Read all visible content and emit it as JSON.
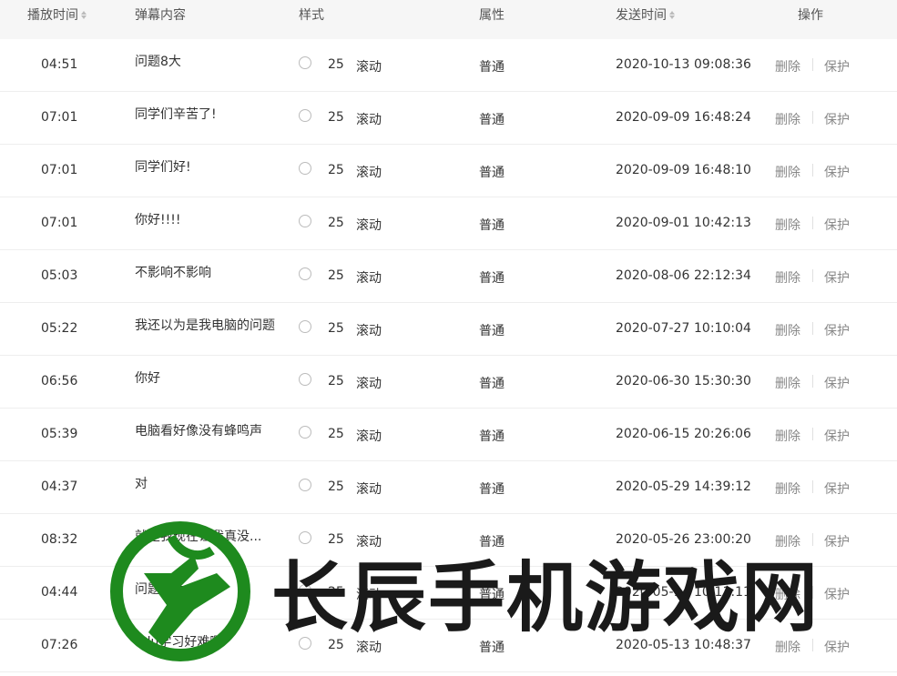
{
  "header": {
    "play_time": "播放时间",
    "content": "弹幕内容",
    "style": "样式",
    "attribute": "属性",
    "send_time": "发送时间",
    "action": "操作"
  },
  "rows": [
    {
      "time": "04:51",
      "text": "问题8大",
      "size": "25",
      "mode": "滚动",
      "attr": "普通",
      "date": "2020-10-13",
      "clock": "09:08:36",
      "del": "删除",
      "protect": "保护"
    },
    {
      "time": "07:01",
      "text": "同学们辛苦了!",
      "size": "25",
      "mode": "滚动",
      "attr": "普通",
      "date": "2020-09-09",
      "clock": "16:48:24",
      "del": "删除",
      "protect": "保护"
    },
    {
      "time": "07:01",
      "text": "同学们好!",
      "size": "25",
      "mode": "滚动",
      "attr": "普通",
      "date": "2020-09-09",
      "clock": "16:48:10",
      "del": "删除",
      "protect": "保护"
    },
    {
      "time": "07:01",
      "text": "你好!!!!",
      "size": "25",
      "mode": "滚动",
      "attr": "普通",
      "date": "2020-09-01",
      "clock": "10:42:13",
      "del": "删除",
      "protect": "保护"
    },
    {
      "time": "05:03",
      "text": "不影响不影响",
      "size": "25",
      "mode": "滚动",
      "attr": "普通",
      "date": "2020-08-06",
      "clock": "22:12:34",
      "del": "删除",
      "protect": "保护"
    },
    {
      "time": "05:22",
      "text": "我还以为是我电脑的问题",
      "size": "25",
      "mode": "滚动",
      "attr": "普通",
      "date": "2020-07-27",
      "clock": "10:10:04",
      "del": "删除",
      "protect": "保护"
    },
    {
      "time": "06:56",
      "text": "你好",
      "size": "25",
      "mode": "滚动",
      "attr": "普通",
      "date": "2020-06-30",
      "clock": "15:30:30",
      "del": "删除",
      "protect": "保护"
    },
    {
      "time": "05:39",
      "text": "电脑看好像没有蜂鸣声",
      "size": "25",
      "mode": "滚动",
      "attr": "普通",
      "date": "2020-06-15",
      "clock": "20:26:06",
      "del": "删除",
      "protect": "保护"
    },
    {
      "time": "04:37",
      "text": "对",
      "size": "25",
      "mode": "滚动",
      "attr": "普通",
      "date": "2020-05-29",
      "clock": "14:39:12",
      "del": "删除",
      "protect": "保护"
    },
    {
      "time": "08:32",
      "text": "就是我现在让我真没...",
      "size": "25",
      "mode": "滚动",
      "attr": "普通",
      "date": "2020-05-26",
      "clock": "23:00:20",
      "del": "删除",
      "protect": "保护"
    },
    {
      "time": "04:44",
      "text": "问题不大",
      "size": "25",
      "mode": "滚动",
      "attr": "普通",
      "date": "2020-05-14",
      "clock": "10:11:11",
      "del": "删除",
      "protect": "保护"
    },
    {
      "time": "07:26",
      "text": "edu学习好难啊",
      "size": "25",
      "mode": "滚动",
      "attr": "普通",
      "date": "2020-05-13",
      "clock": "10:48:37",
      "del": "删除",
      "protect": "保护"
    }
  ],
  "watermark": {
    "text": "长辰手机游戏网",
    "colors": {
      "logo": "#1e8a1e",
      "text": "#1a1a1a"
    }
  }
}
